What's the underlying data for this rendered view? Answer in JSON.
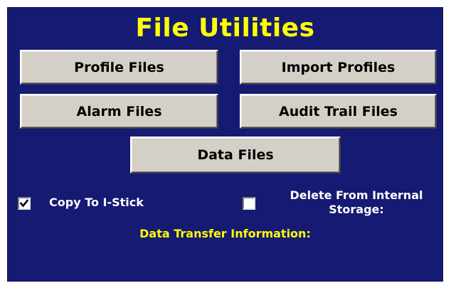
{
  "screen": {
    "title": "File Utilities",
    "background_color": "#151a73",
    "title_color": "#ffff00"
  },
  "buttons": {
    "profile_files": "Profile Files",
    "import_profiles": "Import Profiles",
    "alarm_files": "Alarm Files",
    "audit_trail_files": "Audit Trail Files",
    "data_files": "Data Files"
  },
  "options": {
    "copy_to_istick": {
      "label": "Copy To I-Stick",
      "checked": true,
      "icon": "checkmark-icon"
    },
    "delete_from_internal": {
      "label_line1": "Delete From Internal",
      "label_line2": "Storage:",
      "checked": false
    }
  },
  "info": {
    "label": "Data Transfer Information:",
    "color": "#ffff00"
  }
}
